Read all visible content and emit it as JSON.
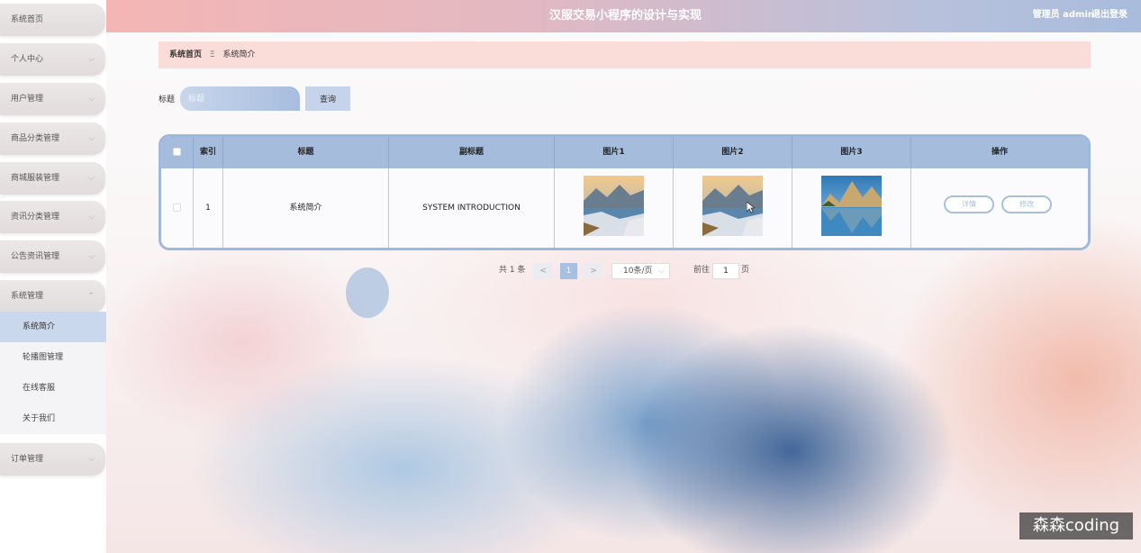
{
  "header": {
    "title": "汉服交易小程序的设计与实现",
    "user": "管理员 admin",
    "logout": "退出登录"
  },
  "sidebar": {
    "items": [
      {
        "label": "系统首页",
        "has_chevron": false
      },
      {
        "label": "个人中心",
        "has_chevron": true
      },
      {
        "label": "用户管理",
        "has_chevron": true
      },
      {
        "label": "商品分类管理",
        "has_chevron": true
      },
      {
        "label": "商城服装管理",
        "has_chevron": true
      },
      {
        "label": "资讯分类管理",
        "has_chevron": true
      },
      {
        "label": "公告资讯管理",
        "has_chevron": true
      },
      {
        "label": "系统管理",
        "has_chevron": true,
        "expanded": true
      },
      {
        "label": "订单管理",
        "has_chevron": true
      }
    ],
    "sub_items": [
      {
        "label": "系统简介",
        "active": true
      },
      {
        "label": "轮播图管理",
        "active": false
      },
      {
        "label": "在线客服",
        "active": false
      },
      {
        "label": "关于我们",
        "active": false
      }
    ]
  },
  "breadcrumb": {
    "home": "系统首页",
    "separator": "Ξ",
    "current": "系统简介"
  },
  "search": {
    "label": "标题",
    "placeholder": "标题",
    "button": "查询"
  },
  "table": {
    "columns": [
      "索引",
      "标题",
      "副标题",
      "图片1",
      "图片2",
      "图片3",
      "操作"
    ],
    "rows": [
      {
        "index": "1",
        "title": "系统简介",
        "subtitle": "SYSTEM INTRODUCTION",
        "images": [
          "landscape-beach",
          "landscape-beach",
          "mountain-lake"
        ],
        "actions": [
          "详情",
          "修改"
        ]
      }
    ]
  },
  "pagination": {
    "total": "共 1 条",
    "prev": "<",
    "current_page": "1",
    "next": ">",
    "page_size": "10条/页",
    "goto_label": "前往",
    "goto_value": "1",
    "page_unit": "页"
  },
  "watermark": "森森coding",
  "colors": {
    "accent": "#a5bcdd",
    "breadcrumb_bg": "#fadcd8",
    "header_left": "#f4b6b4",
    "header_right": "#a9bcdc"
  }
}
